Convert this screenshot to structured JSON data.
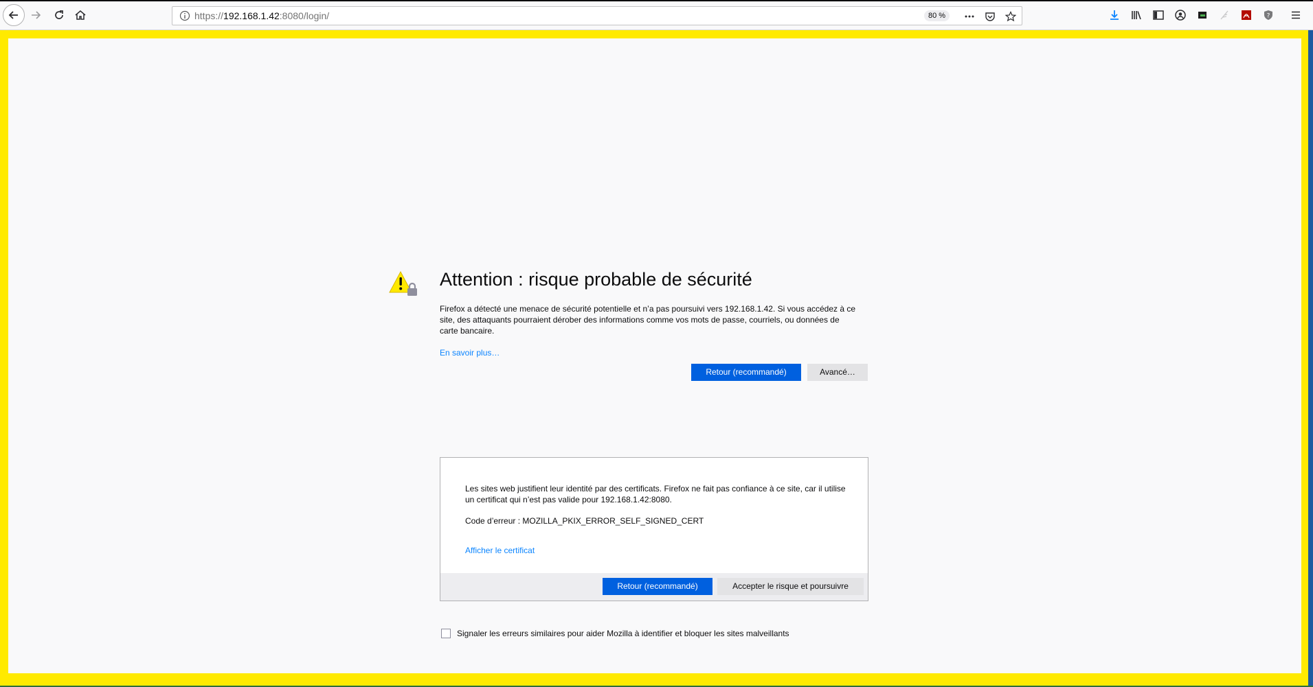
{
  "browser": {
    "url_prefix": "https://",
    "url_host": "192.168.1.42",
    "url_rest": ":8080/login/",
    "zoom": "80 %",
    "toolbar_icons": [
      "back-icon",
      "forward-icon",
      "reload-icon",
      "home-icon",
      "info-icon",
      "more-icon",
      "pocket-icon",
      "bookmark-star-icon",
      "download-icon",
      "library-icon",
      "sidebar-icon",
      "account-icon",
      "extension-icon",
      "feather-icon",
      "pdf-icon",
      "help-icon",
      "menu-icon"
    ]
  },
  "error": {
    "title": "Attention : risque probable de sécurité",
    "description": "Firefox a détecté une menace de sécurité potentielle et n’a pas poursuivi vers 192.168.1.42. Si vous accédez à ce site, des attaquants pourraient dérober des informations comme vos mots de passe, courriels, ou données de carte bancaire.",
    "learn_more": "En savoir plus…",
    "back_button": "Retour (recommandé)",
    "advanced_button": "Avancé…"
  },
  "advanced": {
    "text": "Les sites web justifient leur identité par des certificats. Firefox ne fait pas confiance à ce site, car il utilise un certificat qui n’est pas valide pour 192.168.1.42:8080.",
    "error_code": "Code d’erreur : MOZILLA_PKIX_ERROR_SELF_SIGNED_CERT",
    "view_certificate": "Afficher le certificat",
    "back_button": "Retour (recommandé)",
    "accept_button": "Accepter le risque et poursuivre"
  },
  "report": {
    "label": "Signaler les erreurs similaires pour aider Mozilla à identifier et bloquer les sites malveillants",
    "checked": false
  },
  "colors": {
    "frame": "#ffea00",
    "primary_button": "#0060df",
    "link": "#0a84ff",
    "warning": "#ffe900"
  }
}
